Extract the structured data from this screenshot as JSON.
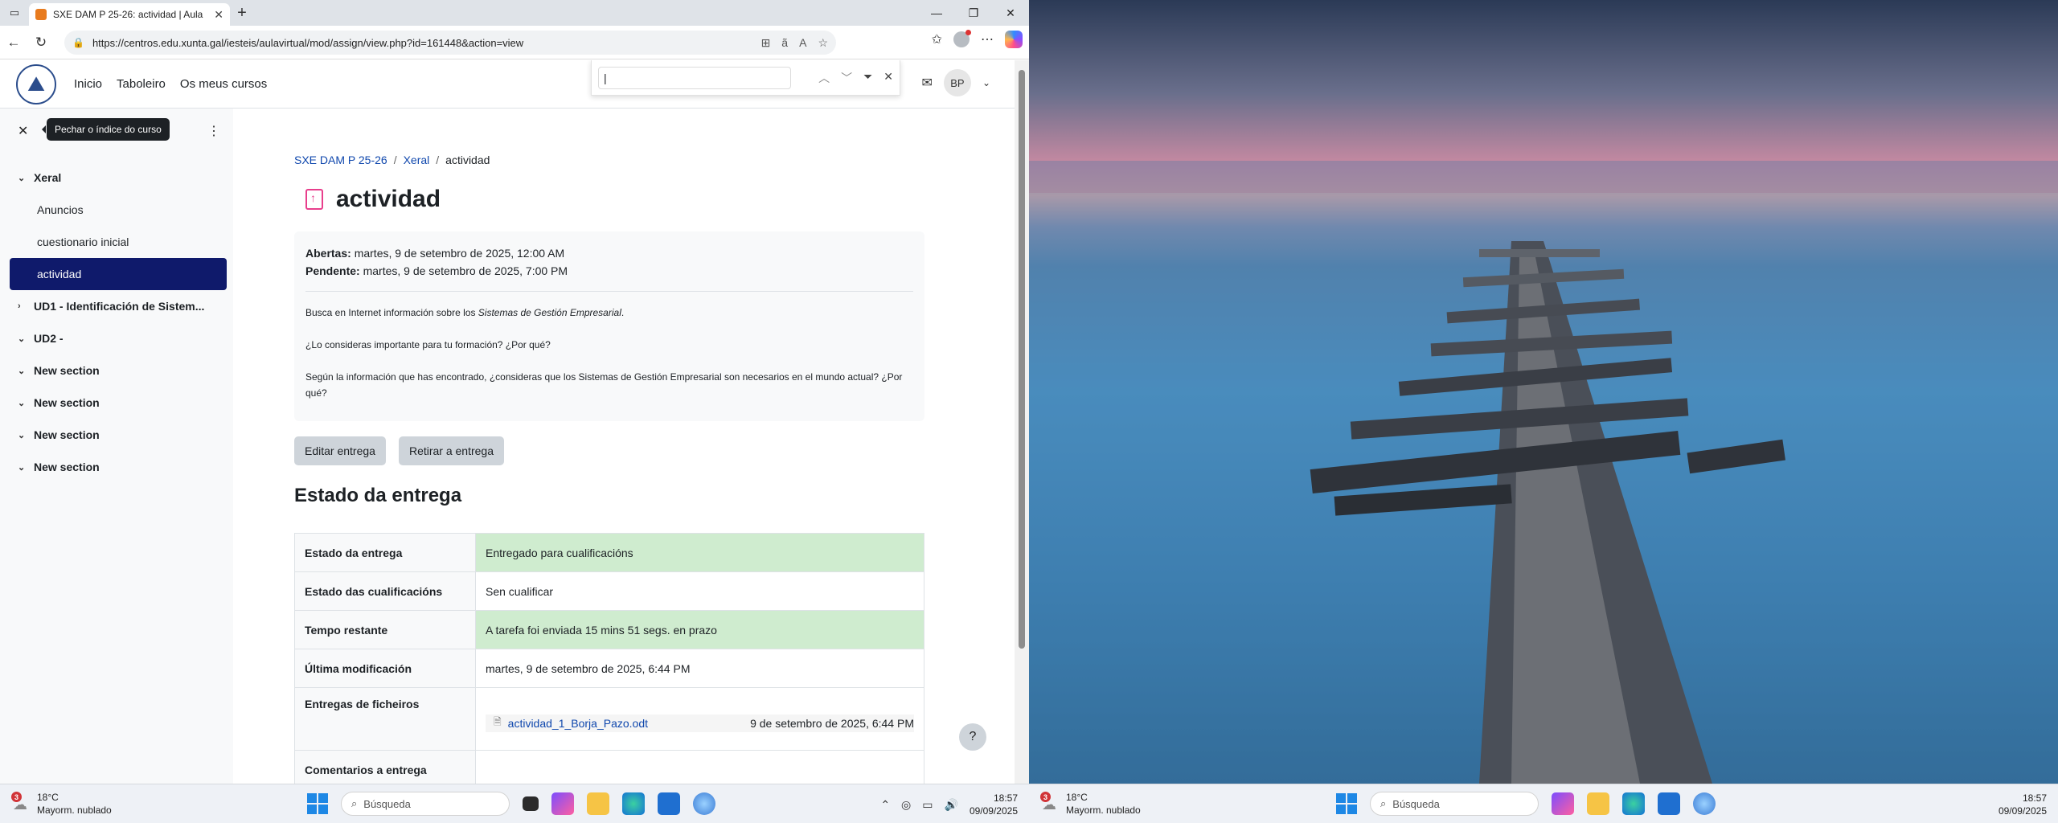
{
  "browser": {
    "tab_title": "SXE DAM P 25-26: actividad | Aula",
    "url": "https://centros.edu.xunta.gal/iesteis/aulavirtual/mod/assign/view.php?id=161448&action=view"
  },
  "site": {
    "menu": [
      "Inicio",
      "Taboleiro",
      "Os meus cursos"
    ],
    "user_initials": "BP"
  },
  "drawer": {
    "tooltip": "Pechar o índice do curso",
    "sections": [
      {
        "label": "Xeral",
        "expanded": true
      },
      {
        "label": "UD1 - Identificación de Sistem..."
      },
      {
        "label": "UD2 -"
      },
      {
        "label": "New section"
      },
      {
        "label": "New section"
      },
      {
        "label": "New section"
      },
      {
        "label": "New section"
      }
    ],
    "activities": [
      "Anuncios",
      "cuestionario inicial",
      "actividad"
    ]
  },
  "breadcrumb": [
    "SXE DAM P 25-26",
    "/",
    "Xeral",
    "/",
    "actividad"
  ],
  "page_title": "actividad",
  "dates": {
    "open_label": "Abertas:",
    "open_value": "martes, 9 de setembro de 2025, 12:00 AM",
    "due_label": "Pendente:",
    "due_value": "martes, 9 de setembro de 2025, 7:00 PM"
  },
  "description": {
    "p1_start": "Busca en Internet información sobre los ",
    "p1_em": "Sistemas de Gestión Empresarial",
    "p1_end": ".",
    "p2": "¿Lo consideras importante para tu formación? ¿Por qué?",
    "p3": "Según la información que has encontrado, ¿consideras que los Sistemas de Gestión Empresarial son necesarios en el mundo actual? ¿Por qué?"
  },
  "buttons": {
    "edit": "Editar entrega",
    "remove": "Retirar a entrega"
  },
  "status": {
    "heading": "Estado da entrega",
    "rows": [
      {
        "label": "Estado da entrega",
        "value": "Entregado para cualificacións"
      },
      {
        "label": "Estado das cualificacións",
        "value": "Sen cualificar"
      },
      {
        "label": "Tempo restante",
        "value": "A tarefa foi enviada 15 mins 51 segs. en prazo"
      },
      {
        "label": "Última modificación",
        "value": "martes, 9 de setembro de 2025, 6:44 PM"
      },
      {
        "label": "Entregas de ficheiros",
        "file_name": "actividad_1_Borja_Pazo.odt",
        "file_date": "9 de setembro de 2025, 6:44 PM"
      },
      {
        "label": "Comentarios a entrega"
      }
    ]
  },
  "help": "?",
  "taskbar": {
    "weather_temp": "18°C",
    "weather_desc": "Mayorm. nublado",
    "weather_badge": "3",
    "search_placeholder": "Búsqueda",
    "time": "18:57",
    "date": "09/09/2025"
  },
  "colors": {
    "accent": "#0f1a6b",
    "success_bg": "#cfeccf",
    "link": "#0f47ad"
  }
}
